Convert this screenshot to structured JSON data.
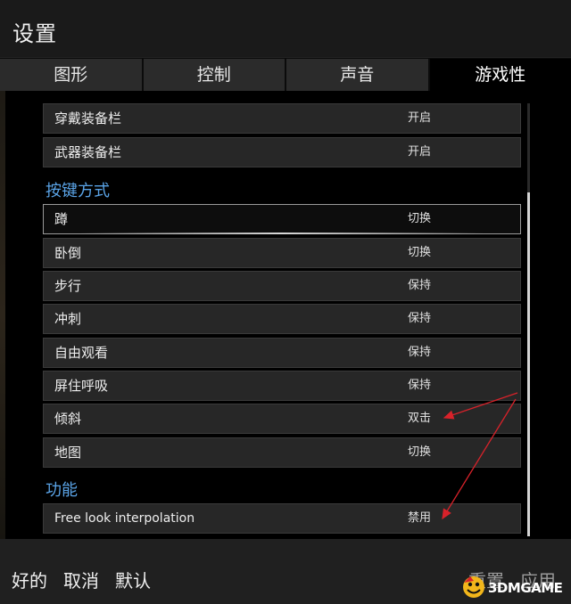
{
  "window": {
    "title": "设置"
  },
  "tabs": [
    {
      "label": "图形",
      "active": false
    },
    {
      "label": "控制",
      "active": false
    },
    {
      "label": "声音",
      "active": false
    },
    {
      "label": "游戏性",
      "active": true
    }
  ],
  "rows_top": [
    {
      "label": "穿戴装备栏",
      "value": "开启"
    },
    {
      "label": "武器装备栏",
      "value": "开启"
    }
  ],
  "section_keys": {
    "title": "按键方式",
    "rows": [
      {
        "label": "蹲",
        "value": "切换",
        "selected": true
      },
      {
        "label": "卧倒",
        "value": "切换"
      },
      {
        "label": "步行",
        "value": "保持"
      },
      {
        "label": "冲刺",
        "value": "保持"
      },
      {
        "label": "自由观看",
        "value": "保持"
      },
      {
        "label": "屏住呼吸",
        "value": "保持"
      },
      {
        "label": "倾斜",
        "value": "双击"
      },
      {
        "label": "地图",
        "value": "切换"
      }
    ]
  },
  "section_func": {
    "title": "功能",
    "rows": [
      {
        "label": "Free look interpolation",
        "value": "禁用"
      }
    ]
  },
  "footer": {
    "ok": "好的",
    "cancel": "取消",
    "default": "默认",
    "reset": "重置",
    "apply": "应用"
  },
  "watermark": {
    "text": "3DMGAME"
  },
  "colors": {
    "section": "#5aa3e6",
    "annotation_arrow": "#d8222a"
  }
}
